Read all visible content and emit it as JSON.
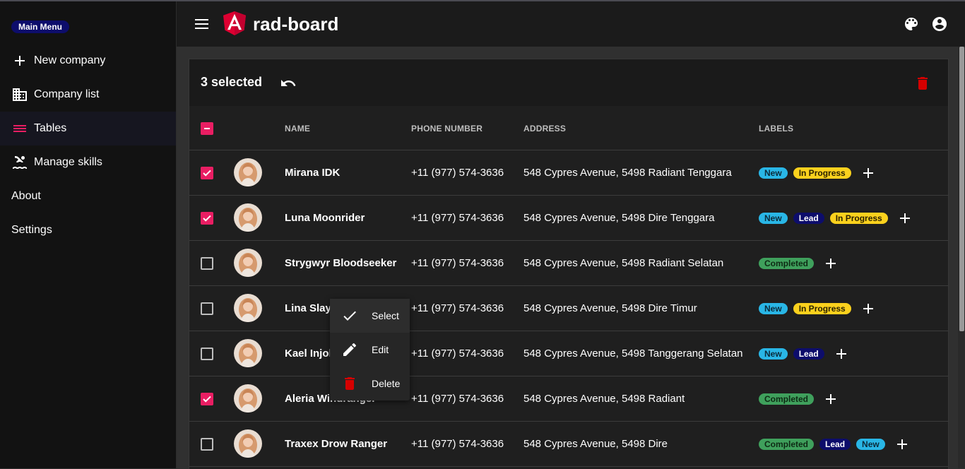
{
  "sidebar": {
    "menu_badge": "Main Menu",
    "items": [
      {
        "label": "New company",
        "icon": "plus-icon"
      },
      {
        "label": "Company list",
        "icon": "building-icon"
      },
      {
        "label": "Tables",
        "icon": "list-icon",
        "active": true
      },
      {
        "label": "Manage skills",
        "icon": "swimming-icon"
      },
      {
        "label": "About"
      },
      {
        "label": "Settings"
      }
    ]
  },
  "header": {
    "title": "rad-board",
    "logo": "angular-logo",
    "icons": [
      "menu-icon",
      "palette-icon",
      "account-circle-icon"
    ]
  },
  "toolbar": {
    "selected_text": "3 selected",
    "undo_icon": "undo-icon",
    "delete_icon": "delete-icon"
  },
  "table": {
    "headers": {
      "name": "NAME",
      "phone": "PHONE NUMBER",
      "address": "ADDRESS",
      "labels": "LABELS"
    },
    "rows": [
      {
        "checked": true,
        "name": "Mirana IDK",
        "phone": "+11 (977) 574-3636",
        "address": "548 Cypres Avenue, 5498 Radiant Tenggara",
        "labels": [
          "New",
          "In Progress"
        ]
      },
      {
        "checked": true,
        "name": "Luna Moonrider",
        "phone": "+11 (977) 574-3636",
        "address": "548 Cypres Avenue, 5498 Dire Tenggara",
        "labels": [
          "New",
          "Lead",
          "In Progress"
        ]
      },
      {
        "checked": false,
        "name": "Strygwyr Bloodseeker",
        "phone": "+11 (977) 574-3636",
        "address": "548 Cypres Avenue, 5498 Radiant Selatan",
        "labels": [
          "Completed"
        ]
      },
      {
        "checked": false,
        "name": "Lina Slayer",
        "phone": "+11 (977) 574-3636",
        "address": "548 Cypres Avenue, 5498 Dire Timur",
        "labels": [
          "New",
          "In Progress"
        ]
      },
      {
        "checked": false,
        "name": "Kael Injoker",
        "phone": "+11 (977) 574-3636",
        "address": "548 Cypres Avenue, 5498 Tanggerang Selatan",
        "labels": [
          "New",
          "Lead"
        ]
      },
      {
        "checked": true,
        "name": "Aleria Windranger",
        "phone": "+11 (977) 574-3636",
        "address": "548 Cypres Avenue, 5498 Radiant",
        "labels": [
          "Completed"
        ]
      },
      {
        "checked": false,
        "name": "Traxex Drow Ranger",
        "phone": "+11 (977) 574-3636",
        "address": "548 Cypres Avenue, 5498 Dire",
        "labels": [
          "Completed",
          "Lead",
          "New"
        ]
      }
    ]
  },
  "label_colors": {
    "New": {
      "bg": "#29b6e6",
      "fg": "#0b2a3a"
    },
    "In Progress": {
      "bg": "#fbd11d",
      "fg": "#2b2200"
    },
    "Lead": {
      "bg": "#0d0d6b",
      "fg": "#ffffff"
    },
    "Completed": {
      "bg": "#3fa05c",
      "fg": "#0e2a14"
    }
  },
  "context_menu": {
    "items": [
      {
        "label": "Select",
        "icon": "check-icon"
      },
      {
        "label": "Edit",
        "icon": "pencil-icon"
      },
      {
        "label": "Delete",
        "icon": "trash-icon"
      }
    ]
  },
  "colors": {
    "accent": "#e91e63",
    "danger": "#d50000"
  }
}
